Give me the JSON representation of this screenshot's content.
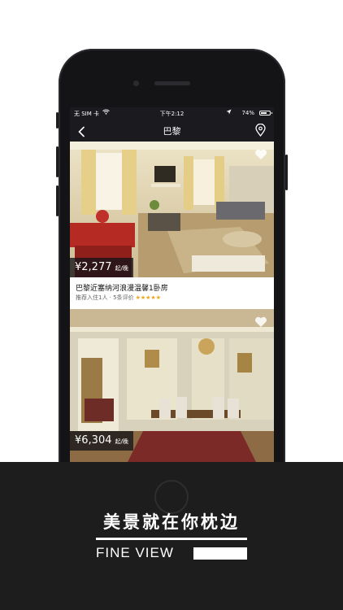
{
  "status_bar": {
    "carrier": "无 SIM 卡",
    "time": "下午2:12",
    "battery_percent": "74%",
    "battery_level": 0.74
  },
  "nav": {
    "title": "巴黎"
  },
  "listings": [
    {
      "price": "¥2,277",
      "per": "起/晚",
      "title": "巴黎近塞纳河浪漫温馨1卧房",
      "meta": "推荐入住1人 · 5条评价",
      "stars": "★★★★★"
    },
    {
      "price": "¥6,304",
      "per": "起/晚"
    }
  ],
  "promo": {
    "slogan": "美景就在你枕边",
    "brand": "FINE VIEW"
  },
  "colors": {
    "band": "#1d1d1d",
    "star": "#f2a51b",
    "nav_bg": "#1b1b1f"
  }
}
